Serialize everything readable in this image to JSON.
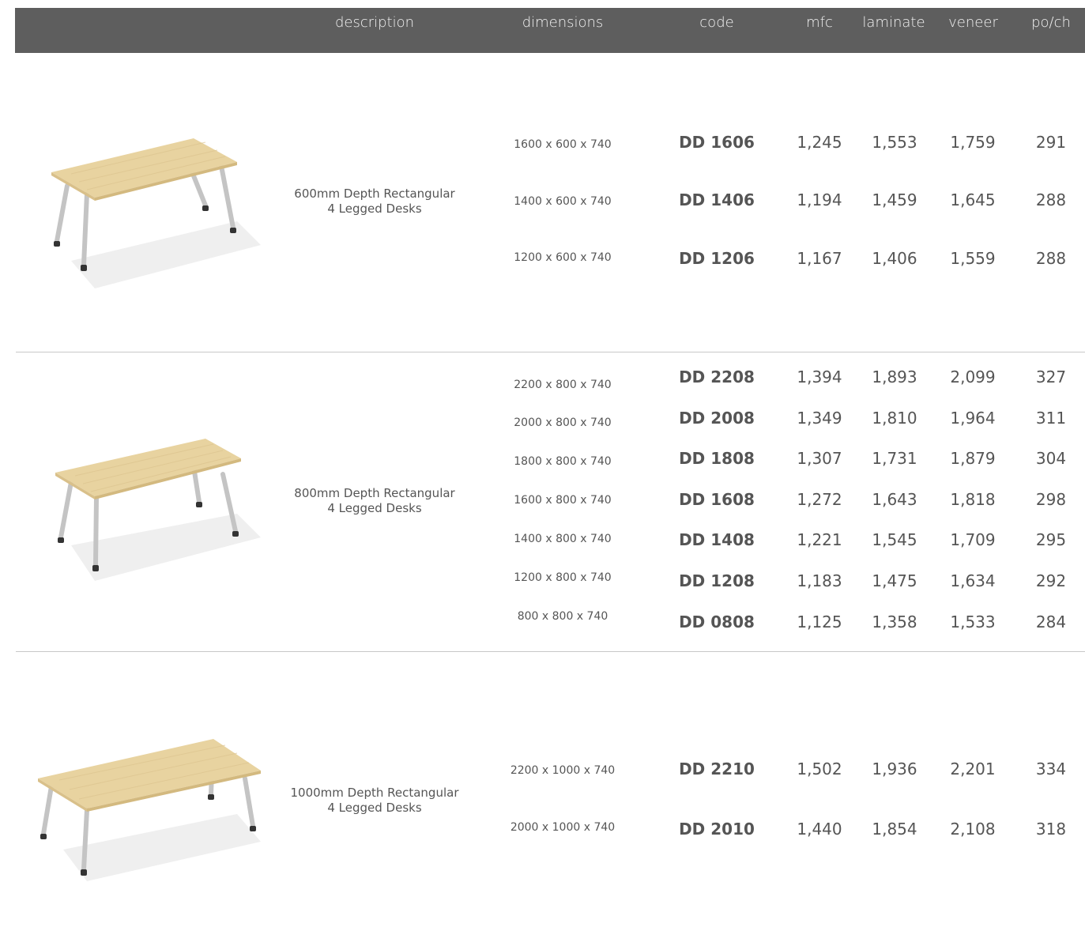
{
  "header": {
    "description": "description",
    "dimensions": "dimensions",
    "code": "code",
    "mfc": "mfc",
    "laminate": "laminate",
    "veneer": "veneer",
    "poch": "po/ch"
  },
  "groups": [
    {
      "description_line1": "600mm Depth Rectangular",
      "description_line2": "4 Legged Desks",
      "image": "desk-600-depth-image",
      "rows": [
        {
          "dimensions": "1600 x 600 x 740",
          "code": "DD 1606",
          "mfc": "1,245",
          "laminate": "1,553",
          "veneer": "1,759",
          "poch": "291"
        },
        {
          "dimensions": "1400 x 600 x 740",
          "code": "DD 1406",
          "mfc": "1,194",
          "laminate": "1,459",
          "veneer": "1,645",
          "poch": "288"
        },
        {
          "dimensions": "1200 x 600 x 740",
          "code": "DD 1206",
          "mfc": "1,167",
          "laminate": "1,406",
          "veneer": "1,559",
          "poch": "288"
        }
      ]
    },
    {
      "description_line1": "800mm Depth Rectangular",
      "description_line2": "4 Legged Desks",
      "image": "desk-800-depth-image",
      "rows": [
        {
          "dimensions": "2200 x 800 x 740",
          "code": "DD 2208",
          "mfc": "1,394",
          "laminate": "1,893",
          "veneer": "2,099",
          "poch": "327"
        },
        {
          "dimensions": "2000 x 800 x 740",
          "code": "DD 2008",
          "mfc": "1,349",
          "laminate": "1,810",
          "veneer": "1,964",
          "poch": "311"
        },
        {
          "dimensions": "1800 x 800 x 740",
          "code": "DD 1808",
          "mfc": "1,307",
          "laminate": "1,731",
          "veneer": "1,879",
          "poch": "304"
        },
        {
          "dimensions": "1600 x 800 x 740",
          "code": "DD 1608",
          "mfc": "1,272",
          "laminate": "1,643",
          "veneer": "1,818",
          "poch": "298"
        },
        {
          "dimensions": "1400 x 800 x 740",
          "code": "DD 1408",
          "mfc": "1,221",
          "laminate": "1,545",
          "veneer": "1,709",
          "poch": "295"
        },
        {
          "dimensions": "1200 x 800 x 740",
          "code": "DD 1208",
          "mfc": "1,183",
          "laminate": "1,475",
          "veneer": "1,634",
          "poch": "292"
        },
        {
          "dimensions": "800 x 800 x 740",
          "code": "DD 0808",
          "mfc": "1,125",
          "laminate": "1,358",
          "veneer": "1,533",
          "poch": "284"
        }
      ]
    },
    {
      "description_line1": "1000mm Depth Rectangular",
      "description_line2": "4 Legged Desks",
      "image": "desk-1000-depth-image",
      "rows": [
        {
          "dimensions": "2200 x 1000 x 740",
          "code": "DD 2210",
          "mfc": "1,502",
          "laminate": "1,936",
          "veneer": "2,201",
          "poch": "334"
        },
        {
          "dimensions": "2000 x 1000 x 740",
          "code": "DD 2010",
          "mfc": "1,440",
          "laminate": "1,854",
          "veneer": "2,108",
          "poch": "318"
        }
      ]
    }
  ],
  "colors": {
    "header_bg": "#5e5e5e",
    "header_text": "#f2f2f2",
    "body_text": "#555555",
    "wood_top": "#e8d3a0",
    "leg_metal": "#c9c9c9"
  }
}
